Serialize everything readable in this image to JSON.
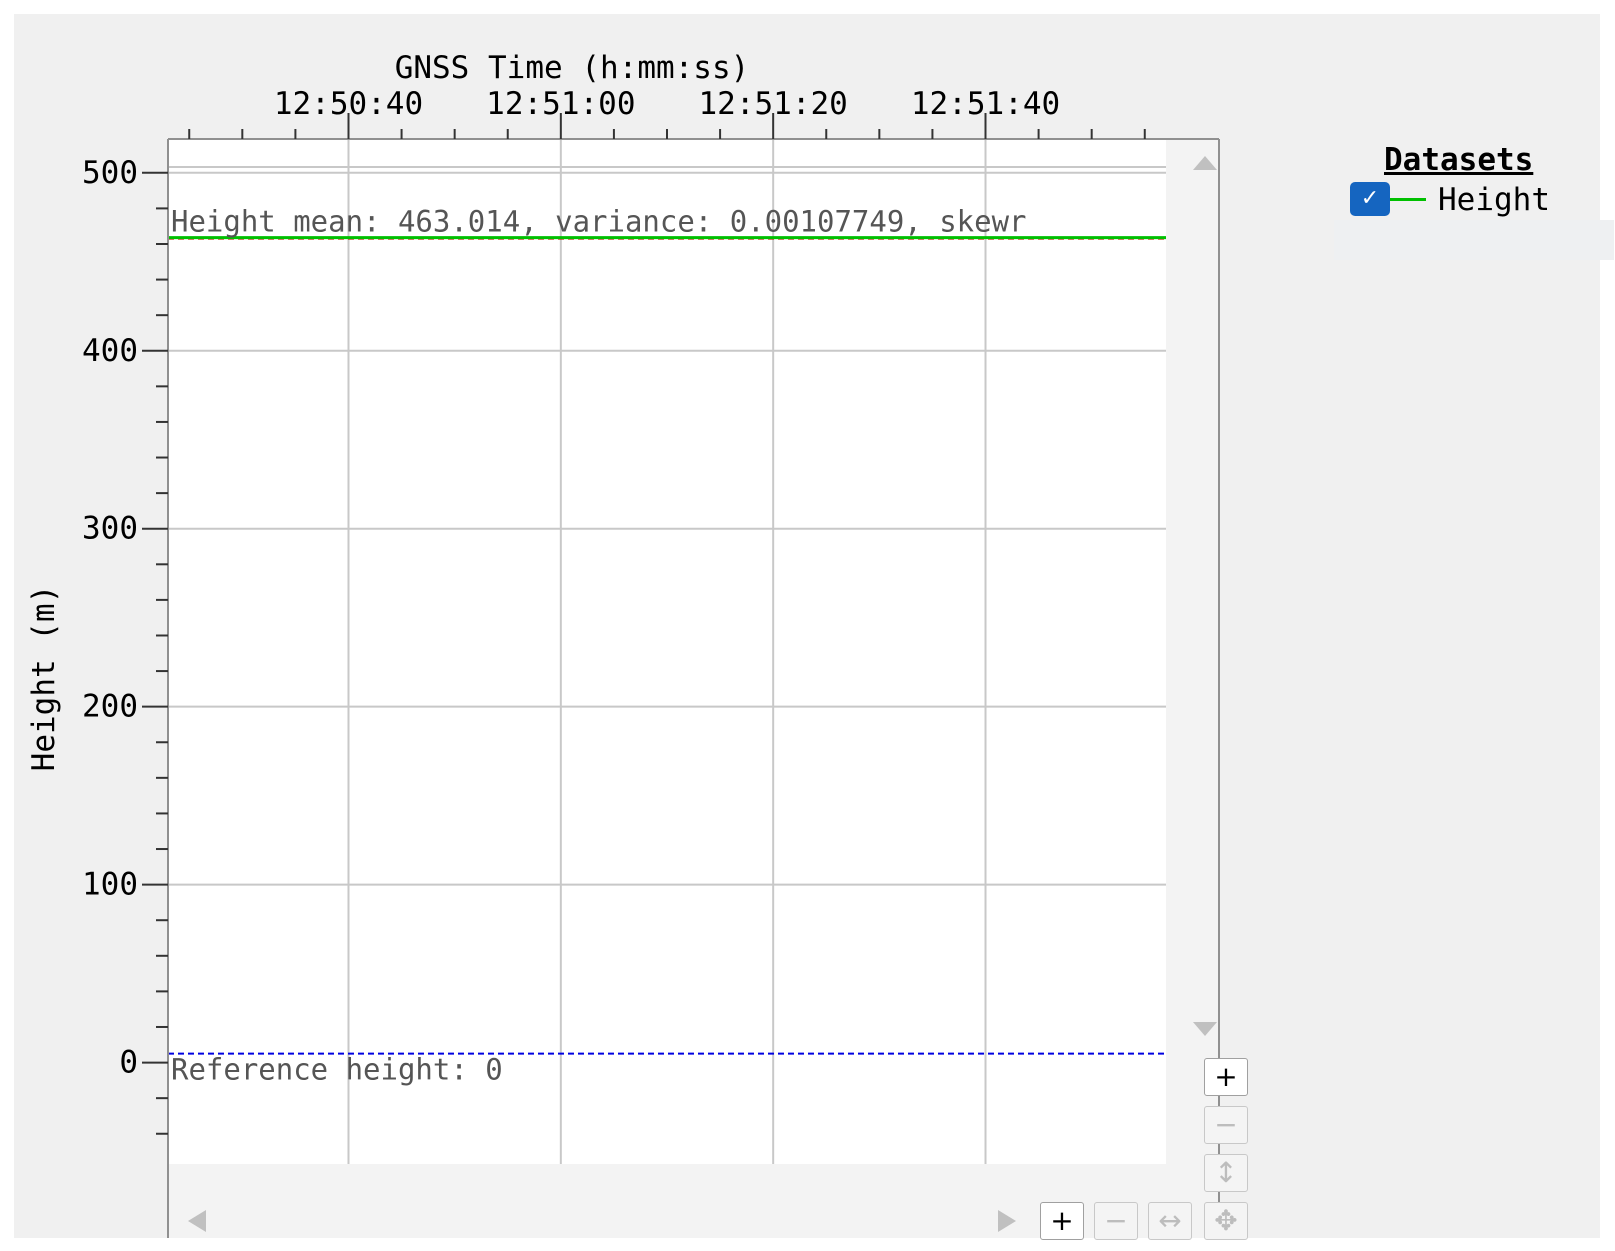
{
  "legend": {
    "title": "Datasets",
    "items": [
      {
        "label": "Height",
        "checked": true,
        "color": "#00c000",
        "check_icon": "✓"
      }
    ]
  },
  "controls": {
    "zoom_in": "+",
    "zoom_out": "−",
    "pan_vertical": "↕",
    "pan_horizontal": "↔",
    "pan_all": "✥"
  },
  "chart_data": {
    "type": "line",
    "title": "",
    "xlabel": "GNSS Time (h:mm:ss)",
    "ylabel": "Height (m)",
    "x_axis_position": "top",
    "x_ticks": [
      "12:50:40",
      "12:51:00",
      "12:51:20",
      "12:51:40"
    ],
    "x_range": [
      "12:50:23",
      "12:51:57"
    ],
    "y_ticks": [
      0,
      100,
      200,
      300,
      400,
      500
    ],
    "ylim": [
      -57,
      519
    ],
    "grid": true,
    "legend_position": "right",
    "series": [
      {
        "name": "Height",
        "color": "#00c000",
        "x": [
          "12:50:23",
          "12:51:57"
        ],
        "values": [
          463.014,
          463.014
        ]
      }
    ],
    "reference_lines": [
      {
        "value": 463.014,
        "color": "#e00000",
        "style": "dashed",
        "label": "Height mean: 463.014, variance: 0.00107749, skewr"
      },
      {
        "value": 5,
        "color": "#0000e0",
        "style": "dashed",
        "label": "Reference height: 0"
      }
    ]
  }
}
